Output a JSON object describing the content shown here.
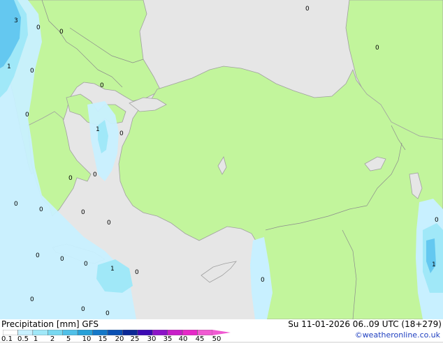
{
  "header": {
    "product": "Precipitation [mm]",
    "model": "GFS",
    "valid_time": "Su 11-01-2026 06..09 UTC (18+279)",
    "credit": "©weatheronline.co.uk"
  },
  "legend": {
    "ticks": [
      "0.1",
      "0.5",
      "1",
      "2",
      "5",
      "10",
      "15",
      "20",
      "25",
      "30",
      "35",
      "40",
      "45",
      "50"
    ],
    "colors": [
      "#ffffff",
      "#c8f0ff",
      "#a0e8f8",
      "#78d8f0",
      "#50c0e8",
      "#28a0d8",
      "#1478c8",
      "#0a50b4",
      "#0a2896",
      "#3c0ab4",
      "#8c14c8",
      "#c81ec8",
      "#e628c8",
      "#f05ad2"
    ]
  },
  "map": {
    "colors": {
      "sea": "#e6e6e6",
      "land": "#c2f59c",
      "precip_light": "#c8f0ff",
      "precip_mid": "#a0e8f8",
      "precip_heavy": "#64c8f0",
      "border": "#8c8c8c",
      "coast": "#a0a0a0"
    },
    "values": [
      "3",
      "0",
      "0",
      "1",
      "0",
      "0",
      "0",
      "0",
      "1",
      "0",
      "0",
      "0",
      "0",
      "0",
      "0",
      "0",
      "0",
      "1",
      "0",
      "0",
      "0",
      "0",
      "0",
      "0",
      "0",
      "0",
      "1",
      "0"
    ]
  }
}
